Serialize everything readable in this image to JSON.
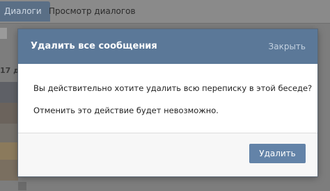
{
  "background": {
    "tabs": [
      {
        "label": "Диалоги",
        "active": true
      },
      {
        "label": "Просмотр диалогов",
        "active": false
      }
    ],
    "count_fragment": "17 д"
  },
  "dialog": {
    "title": "Удалить все сообщения",
    "close_label": "Закрыть",
    "message": "Вы действительно хотите удалить всю переписку в этой беседе?",
    "warning": "Отменить это действие будет невозможно.",
    "confirm_label": "Удалить"
  },
  "colors": {
    "header": "#5b7898",
    "button": "#6383a8",
    "overlay": "#7d7d7d"
  }
}
